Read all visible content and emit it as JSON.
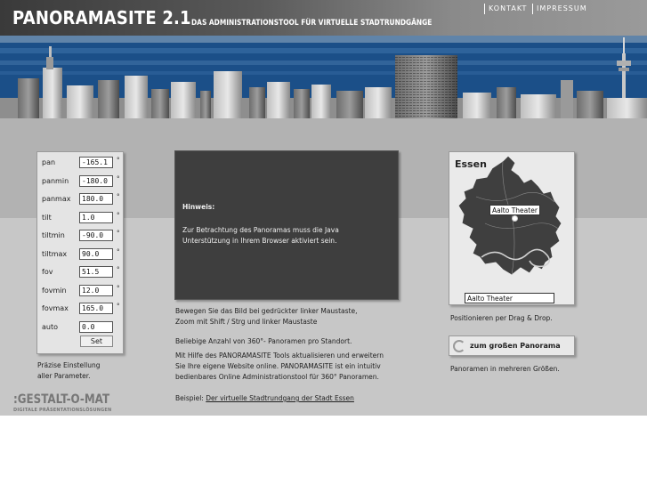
{
  "header": {
    "title": "PANORAMASITE 2.1",
    "subtitle": "DAS ADMINISTRATIONSTOOL FÜR VIRTUELLE STADTRUNDGÄNGE",
    "nav": [
      "KONTAKT",
      "IMPRESSUM"
    ]
  },
  "params": {
    "rows": [
      {
        "label": "pan",
        "value": "-165.1",
        "unit": "°"
      },
      {
        "label": "panmin",
        "value": "-180.0",
        "unit": "°"
      },
      {
        "label": "panmax",
        "value": "180.0",
        "unit": "°"
      },
      {
        "label": "tilt",
        "value": "1.0",
        "unit": "°"
      },
      {
        "label": "tiltmin",
        "value": "-90.0",
        "unit": "°"
      },
      {
        "label": "tiltmax",
        "value": "90.0",
        "unit": "°"
      },
      {
        "label": "fov",
        "value": "51.5",
        "unit": "°"
      },
      {
        "label": "fovmin",
        "value": "12.0",
        "unit": "°"
      },
      {
        "label": "fovmax",
        "value": "165.0",
        "unit": "°"
      },
      {
        "label": "auto",
        "value": "0.0",
        "unit": ""
      }
    ],
    "set_label": "Set",
    "caption_line1": "Präzise Einstellung",
    "caption_line2": "aller Parameter."
  },
  "brand": {
    "name": ":GESTALT-O-MAT",
    "tagline": "DIGITALE PRÄSENTATIONSLÖSUNGEN"
  },
  "applet": {
    "heading": "Hinweis:",
    "text": "Zur Betrachtung des Panoramas muss die Java Unterstützung in Ihrem Browser aktiviert sein."
  },
  "main": {
    "drag_line1": "Bewegen Sie das Bild bei gedrückter linker Maustaste,",
    "drag_line2": "Zoom mit Shift / Strg und linker Maustaste",
    "count_text": "Beliebige Anzahl von 360°- Panoramen pro Standort.",
    "desc_line1": "Mit Hilfe des PANORAMASITE Tools aktualisieren und erweitern",
    "desc_line2": "Sie Ihre eigene Website online. PANORAMASITE ist ein intuitiv",
    "desc_line3": "bedienbares Online Administrationstool für 360° Panoramen.",
    "example_prefix": "Beispiel: ",
    "example_link": "Der virtuelle Stadtrundgang der Stadt Essen"
  },
  "map": {
    "title": "Essen",
    "marker_label": "Aalto Theater",
    "selected_location": "Aalto Theater",
    "caption": "Positionieren per Drag & Drop.",
    "big_panorama_label": "zum großen Panorama",
    "sizes_caption": "Panoramen in mehreren Größen."
  },
  "colors": {
    "sky": "#1a4d86",
    "band_top": "#b2b2b2",
    "band_bottom": "#c7c7c7",
    "applet_bg": "#3e3e3e"
  }
}
